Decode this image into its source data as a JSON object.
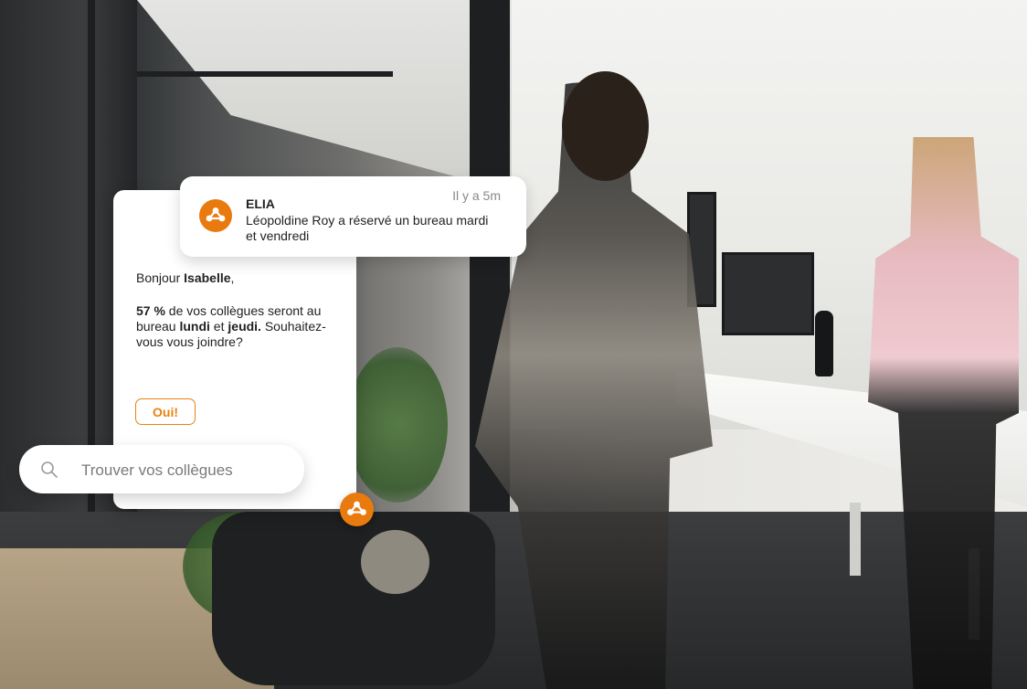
{
  "notification": {
    "sender": "ELIA",
    "time": "Il y a 5m",
    "message": "Léopoldine Roy a réservé un bureau mardi et vendredi",
    "logo_icon": "elia-logo-icon"
  },
  "main_card": {
    "greeting_prefix": "Bonjour ",
    "greeting_name": "Isabelle",
    "greeting_suffix": ",",
    "stat_percent": "57 %",
    "stat_text_1": " de vos collègues seront au bureau ",
    "stat_day_1": "lundi",
    "stat_text_2": " et ",
    "stat_day_2": "jeudi.",
    "stat_text_3": " Souhaitez-vous vous joindre?",
    "button_label": "Oui!"
  },
  "search": {
    "placeholder": "Trouver vos collègues",
    "icon": "search-icon"
  },
  "fab": {
    "icon": "elia-logo-icon"
  },
  "colors": {
    "accent": "#e87a0e",
    "text": "#222222",
    "muted": "#8a8a8a"
  }
}
